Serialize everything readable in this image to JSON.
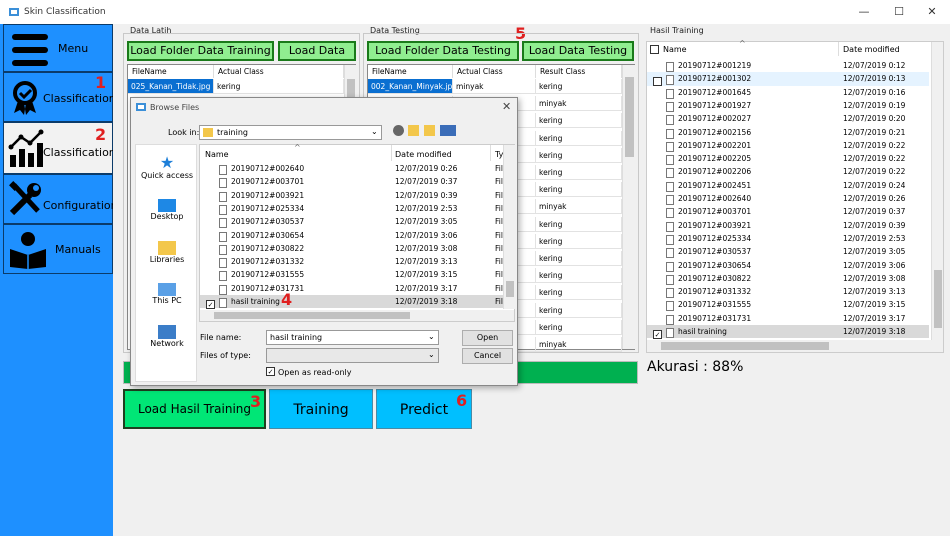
{
  "window": {
    "title": "Skin Classification",
    "controls": [
      "—",
      "☐",
      "✕"
    ]
  },
  "sidebar": {
    "items": [
      {
        "label": "Menu",
        "icon": "hamburger-icon",
        "badge": ""
      },
      {
        "label": "Classification",
        "icon": "award-icon",
        "badge": "1"
      },
      {
        "label": "Classification",
        "icon": "chart-icon",
        "badge": "2"
      },
      {
        "label": "Configuration",
        "icon": "tools-icon",
        "badge": ""
      },
      {
        "label": "Manuals",
        "icon": "reader-icon",
        "badge": ""
      }
    ]
  },
  "data_latih": {
    "title": "Data Latih",
    "load_folder_label": "Load Folder Data Training",
    "load_data_label": "Load Data",
    "columns": [
      "FileName",
      "Actual Class"
    ],
    "rows": [
      [
        "025_Kanan_Tidak.jpg",
        "kering"
      ]
    ]
  },
  "data_testing": {
    "title": "Data Testing",
    "badge": "5",
    "load_folder_label": "Load Folder Data Testing",
    "load_data_label": "Load Data Testing",
    "columns": [
      "FileName",
      "Actual Class",
      "Result Class"
    ],
    "rows": [
      [
        "002_Kanan_Minyak.jpg",
        "minyak",
        "kering"
      ],
      [
        "",
        "",
        "minyak"
      ],
      [
        "",
        "",
        "kering"
      ],
      [
        "",
        "",
        "kering"
      ],
      [
        "",
        "",
        "kering"
      ],
      [
        "",
        "",
        "kering"
      ],
      [
        "",
        "",
        "kering"
      ],
      [
        "",
        "",
        "minyak"
      ],
      [
        "",
        "",
        "kering"
      ],
      [
        "",
        "",
        "kering"
      ],
      [
        "",
        "",
        "kering"
      ],
      [
        "",
        "",
        "kering"
      ],
      [
        "",
        "",
        "kering"
      ],
      [
        "",
        "",
        "kering"
      ],
      [
        "",
        "",
        "kering"
      ],
      [
        "",
        "",
        "minyak"
      ]
    ]
  },
  "hasil_training": {
    "title": "Hasil Training",
    "columns": [
      "Name",
      "Date modified"
    ],
    "rows": [
      [
        "20190712#001219",
        "12/07/2019 0:12"
      ],
      [
        "20190712#001302",
        "12/07/2019 0:13"
      ],
      [
        "20190712#001645",
        "12/07/2019 0:16"
      ],
      [
        "20190712#001927",
        "12/07/2019 0:19"
      ],
      [
        "20190712#002027",
        "12/07/2019 0:20"
      ],
      [
        "20190712#002156",
        "12/07/2019 0:21"
      ],
      [
        "20190712#002201",
        "12/07/2019 0:22"
      ],
      [
        "20190712#002205",
        "12/07/2019 0:22"
      ],
      [
        "20190712#002206",
        "12/07/2019 0:22"
      ],
      [
        "20190712#002451",
        "12/07/2019 0:24"
      ],
      [
        "20190712#002640",
        "12/07/2019 0:26"
      ],
      [
        "20190712#003701",
        "12/07/2019 0:37"
      ],
      [
        "20190712#003921",
        "12/07/2019 0:39"
      ],
      [
        "20190712#025334",
        "12/07/2019 2:53"
      ],
      [
        "20190712#030537",
        "12/07/2019 3:05"
      ],
      [
        "20190712#030654",
        "12/07/2019 3:06"
      ],
      [
        "20190712#030822",
        "12/07/2019 3:08"
      ],
      [
        "20190712#031332",
        "12/07/2019 3:13"
      ],
      [
        "20190712#031555",
        "12/07/2019 3:15"
      ],
      [
        "20190712#031731",
        "12/07/2019 3:17"
      ],
      [
        "hasil training",
        "12/07/2019 3:18"
      ]
    ],
    "accuracy_text": "Akurasi  : 88%"
  },
  "actions": {
    "load_hasil_label": "Load Hasil Training",
    "load_hasil_badge": "3",
    "training_label": "Training",
    "predict_label": "Predict",
    "predict_badge": "6"
  },
  "progress": {
    "value": 1.0
  },
  "dialog": {
    "title": "Browse Files",
    "look_in_label": "Look in:",
    "look_in_value": "training",
    "columns": [
      "Name",
      "Date modified",
      "Ty"
    ],
    "places": [
      "Quick access",
      "Desktop",
      "Libraries",
      "This PC",
      "Network"
    ],
    "rows": [
      [
        "20190712#002640",
        "12/07/2019 0:26",
        "Fil"
      ],
      [
        "20190712#003701",
        "12/07/2019 0:37",
        "Fil"
      ],
      [
        "20190712#003921",
        "12/07/2019 0:39",
        "Fil"
      ],
      [
        "20190712#025334",
        "12/07/2019 2:53",
        "Fil"
      ],
      [
        "20190712#030537",
        "12/07/2019 3:05",
        "Fil"
      ],
      [
        "20190712#030654",
        "12/07/2019 3:06",
        "Fil"
      ],
      [
        "20190712#030822",
        "12/07/2019 3:08",
        "Fil"
      ],
      [
        "20190712#031332",
        "12/07/2019 3:13",
        "Fil"
      ],
      [
        "20190712#031555",
        "12/07/2019 3:15",
        "Fil"
      ],
      [
        "20190712#031731",
        "12/07/2019 3:17",
        "Fil"
      ],
      [
        "hasil training",
        "12/07/2019 3:18",
        "Fil"
      ]
    ],
    "selected_badge": "4",
    "file_name_label": "File name:",
    "file_name_value": "hasil training",
    "files_of_type_label": "Files of type:",
    "open_label": "Open",
    "cancel_label": "Cancel",
    "readonly_label": "Open as read-only"
  },
  "colors": {
    "sidebar": "#1e90ff",
    "green_button": "#90ee90",
    "progress": "#00b050",
    "cyan_button": "#00bfff"
  }
}
